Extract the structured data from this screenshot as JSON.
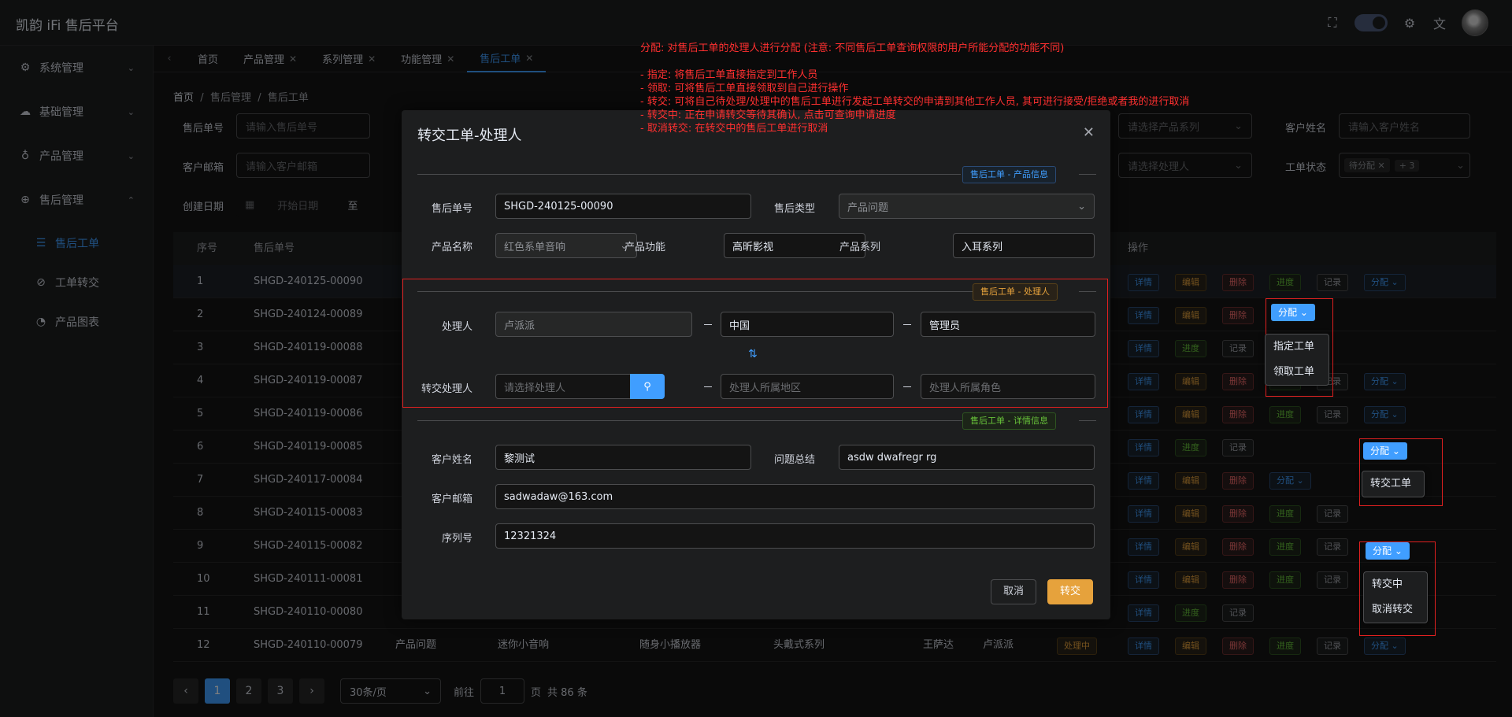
{
  "app": {
    "title": "凯韵 iFi 售后平台"
  },
  "sidebar": {
    "items": [
      {
        "label": "系统管理",
        "icon": "gear-icon"
      },
      {
        "label": "基础管理",
        "icon": "cloud-icon"
      },
      {
        "label": "产品管理",
        "icon": "lamp-icon"
      },
      {
        "label": "售后管理",
        "icon": "plus-circle-icon"
      }
    ],
    "subitems": [
      {
        "label": "售后工单",
        "icon": "sliders-icon"
      },
      {
        "label": "工单转交",
        "icon": "paperclip-icon"
      },
      {
        "label": "产品图表",
        "icon": "bell-icon"
      }
    ]
  },
  "tabs": [
    "首页",
    "产品管理",
    "系列管理",
    "功能管理",
    "售后工单"
  ],
  "breadcrumb": {
    "home": "首页",
    "sep": "/",
    "level1": "售后管理",
    "level2": "售后工单"
  },
  "filters": {
    "order_no_label": "售后单号",
    "order_no_ph": "请输入售后单号",
    "email_label": "客户邮箱",
    "email_ph": "请输入客户邮箱",
    "date_label": "创建日期",
    "date_start_ph": "开始日期",
    "date_to": "至",
    "series_ph": "请选择产品系列",
    "handler_ph": "请选择处理人",
    "customer_label": "客户姓名",
    "customer_ph": "请输入客户姓名",
    "status_label": "工单状态",
    "status_tag": "待分配",
    "status_more": "+ 3"
  },
  "table": {
    "headers": {
      "index": "序号",
      "order_no": "售后单号",
      "actions": "操作"
    },
    "rows": [
      {
        "i": "1",
        "no": "SHGD-240125-00090"
      },
      {
        "i": "2",
        "no": "SHGD-240124-00089"
      },
      {
        "i": "3",
        "no": "SHGD-240119-00088"
      },
      {
        "i": "4",
        "no": "SHGD-240119-00087"
      },
      {
        "i": "5",
        "no": "SHGD-240119-00086"
      },
      {
        "i": "6",
        "no": "SHGD-240119-00085"
      },
      {
        "i": "7",
        "no": "SHGD-240117-00084"
      },
      {
        "i": "8",
        "no": "SHGD-240115-00083"
      },
      {
        "i": "9",
        "no": "SHGD-240115-00082"
      },
      {
        "i": "10",
        "no": "SHGD-240111-00081"
      },
      {
        "i": "11",
        "no": "SHGD-240110-00080"
      },
      {
        "i": "12",
        "no": "SHGD-240110-00079"
      }
    ],
    "row12": {
      "type": "产品问题",
      "product": "迷你小音响",
      "func": "随身小播放器",
      "series": "头戴式系列",
      "customer": "王萨达",
      "handler": "卢派派",
      "status": "处理中"
    },
    "actions": {
      "detail": "详情",
      "edit": "编辑",
      "delete": "删除",
      "progress": "进度",
      "log": "记录",
      "assign": "分配"
    }
  },
  "pagination": {
    "pages": [
      "1",
      "2",
      "3"
    ],
    "size": "30条/页",
    "goto": "前往",
    "page_val": "1",
    "page_unit": "页",
    "total": "共 86 条"
  },
  "dialog": {
    "title": "转交工单-处理人",
    "section_product": "售后工单 - 产品信息",
    "section_handler": "售后工单 - 处理人",
    "section_detail": "售后工单 - 详情信息",
    "order_no_label": "售后单号",
    "order_no": "SHGD-240125-00090",
    "type_label": "售后类型",
    "type": "产品问题",
    "product_label": "产品名称",
    "product": "红色系单音响",
    "func_label": "产品功能",
    "func": "高昕影视",
    "series_label": "产品系列",
    "series": "入耳系列",
    "handler_label": "处理人",
    "handler": "卢派派",
    "handler_region": "中国",
    "handler_role": "管理员",
    "transfer_label": "转交处理人",
    "transfer_ph": "请选择处理人",
    "region_ph": "处理人所属地区",
    "role_ph": "处理人所属角色",
    "customer_label": "客户姓名",
    "customer": "黎测试",
    "summary_label": "问题总结",
    "summary": "asdw dwafregr rg",
    "email_label": "客户邮箱",
    "email": "sadwadaw@163.com",
    "serial_label": "序列号",
    "serial": "12321324",
    "cancel": "取消",
    "submit": "转交"
  },
  "annotation": "分配: 对售后工单的处理人进行分配 (注意: 不同售后工单查询权限的用户所能分配的功能不同)\n\n- 指定: 将售后工单直接指定到工作人员\n- 领取: 可将售后工单直接领取到自己进行操作\n- 转交: 可将自己待处理/处理中的售后工单进行发起工单转交的申请到其他工作人员, 其可进行接受/拒绝或者我的进行取消\n- 转交中: 正在申请转交等待其确认, 点击可查询申请进度\n- 取消转交: 在转交中的售后工单进行取消",
  "dropdowns": {
    "d1": {
      "button": "分配",
      "items": [
        "指定工单",
        "领取工单"
      ]
    },
    "d2": {
      "button": "分配",
      "items": [
        "转交工单"
      ]
    },
    "d3": {
      "button": "分配",
      "items": [
        "转交中",
        "取消转交"
      ]
    }
  },
  "colors": {
    "accent": "#409eff",
    "warning": "#e6a23c",
    "danger": "#f56c6c",
    "success": "#67c23a",
    "annotation": "#ff3030"
  }
}
